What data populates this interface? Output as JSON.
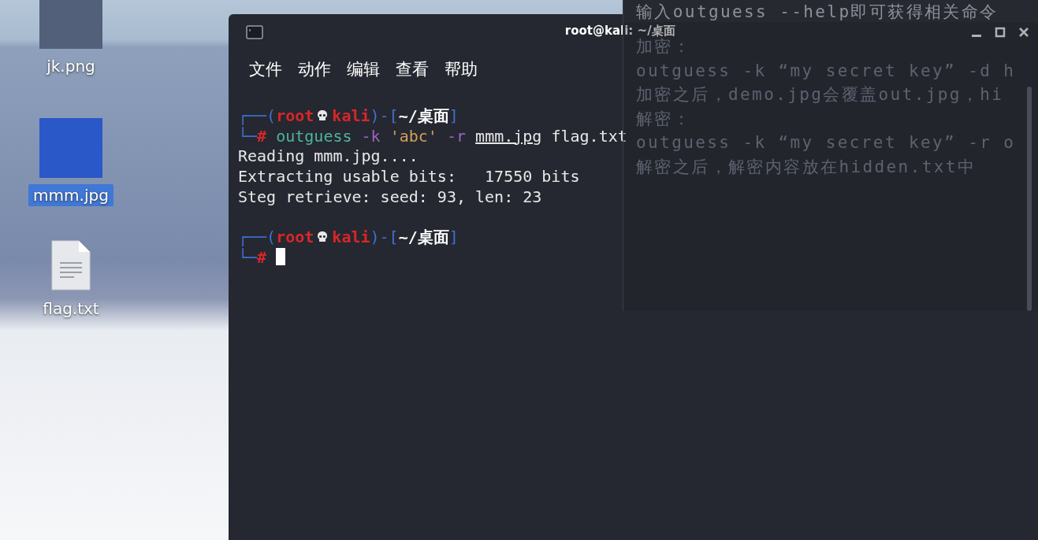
{
  "desktop_icons": [
    {
      "label": "jk.png",
      "kind": "image",
      "selected": false
    },
    {
      "label": "mmm.jpg",
      "kind": "image",
      "selected": true
    },
    {
      "label": "flag.txt",
      "kind": "text",
      "selected": false
    }
  ],
  "background_note": {
    "lines": [
      "输入outguess --help即可获得相关命令",
      "加密：",
      "outguess -k “my secret key” -d h",
      "加密之后，demo.jpg会覆盖out.jpg，hi",
      "解密：",
      "outguess -k “my secret key” -r o",
      "解密之后，解密内容放在hidden.txt中"
    ]
  },
  "terminal": {
    "title": "root@kali: ~/桌面",
    "menu": [
      "文件",
      "动作",
      "编辑",
      "查看",
      "帮助"
    ],
    "lines": [
      {
        "kind": "prompt",
        "top_left": "┌──(",
        "user": "root",
        "host": "kali",
        "separator": ")-[",
        "path": "~/桌面",
        "close": "]",
        "bottom_left": "└─",
        "symbol": "#",
        "command": [
          {
            "kind": "program",
            "text": "outguess"
          },
          {
            "kind": "option",
            "text": "-k"
          },
          {
            "kind": "string",
            "text": "'abc'"
          },
          {
            "kind": "option",
            "text": "-r"
          },
          {
            "kind": "file",
            "text": "mmm.jpg"
          },
          {
            "kind": "arg",
            "text": "flag.txt"
          }
        ]
      },
      {
        "kind": "output",
        "text": "Reading mmm.jpg...."
      },
      {
        "kind": "output",
        "text": "Extracting usable bits:   17550 bits"
      },
      {
        "kind": "output",
        "text": "Steg retrieve: seed: 93, len: 23"
      },
      {
        "kind": "blank"
      },
      {
        "kind": "prompt",
        "top_left": "┌──(",
        "user": "root",
        "host": "kali",
        "separator": ")-[",
        "path": "~/桌面",
        "close": "]",
        "bottom_left": "└─",
        "symbol": "#",
        "cursor": true
      }
    ]
  }
}
